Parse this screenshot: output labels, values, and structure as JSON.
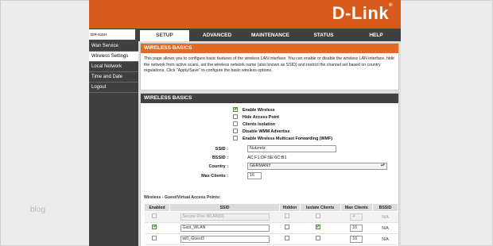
{
  "brand": {
    "logo": "D-Link",
    "trademark": "®",
    "model": "DIR-615H"
  },
  "tabs": [
    {
      "label": "SETUP",
      "active": true
    },
    {
      "label": "ADVANCED",
      "active": false
    },
    {
      "label": "MAINTENANCE",
      "active": false
    },
    {
      "label": "STATUS",
      "active": false
    },
    {
      "label": "HELP",
      "active": false
    }
  ],
  "nav": [
    {
      "label": "Wan Service",
      "active": false
    },
    {
      "label": "Wireless Settings",
      "active": true
    },
    {
      "label": "Local Network",
      "active": false
    },
    {
      "label": "Time and Date",
      "active": false
    },
    {
      "label": "Logout",
      "active": false
    }
  ],
  "intro": {
    "title": "WIRELESS BASICS",
    "text": "This page allows you to configure basic features of the wireless LAN interface. You can enable or disable the wireless LAN interface, hide the network from active scans, set the wireless network name (also known as SSID) and restrict the channel set based on country regulations. Click \"Apply/Save\" to configure the basic wireless options."
  },
  "basics": {
    "title": "WIRELESS BASICS",
    "options": [
      {
        "label": "Enable Wireless",
        "checked": true
      },
      {
        "label": "Hide Access Point",
        "checked": false
      },
      {
        "label": "Clients Isolation",
        "checked": false
      },
      {
        "label": "Disable WMM Advertise",
        "checked": false
      },
      {
        "label": "Enable Wireless Multicast Forwarding (WMF)",
        "checked": false
      }
    ],
    "ssid_label": "SSID :",
    "ssid_value": "Nutzretz",
    "bssid_label": "BSSID :",
    "bssid_value": "AC:F1:DF:5E:6C:B1",
    "country_label": "Country :",
    "country_value": "GERMANY",
    "maxclients_label": "Max Clients :",
    "maxclients_value": "16"
  },
  "guest": {
    "title": "Wireless - Guest/Virtual Access Points:",
    "columns": [
      "Enabled",
      "SSID",
      "Hidden",
      "Isolate Clients",
      "Max Clients",
      "BSSID"
    ],
    "rows": [
      {
        "enabled": false,
        "ssid": "Secure Free WLAN(D)",
        "hidden": false,
        "isolate": false,
        "max": "4",
        "bssid": "N/A",
        "disabled": true
      },
      {
        "enabled": true,
        "ssid": "Gast_WLAN",
        "hidden": false,
        "isolate": true,
        "max": "16",
        "bssid": "N/A",
        "disabled": false
      },
      {
        "enabled": false,
        "ssid": "wl0_Guest3",
        "hidden": false,
        "isolate": false,
        "max": "16",
        "bssid": "N/A",
        "disabled": false
      }
    ]
  },
  "watermark": "blog",
  "colors": {
    "brand_orange": "#d75a1a",
    "dark_bar": "#404040",
    "section_orange": "#e26a22"
  }
}
